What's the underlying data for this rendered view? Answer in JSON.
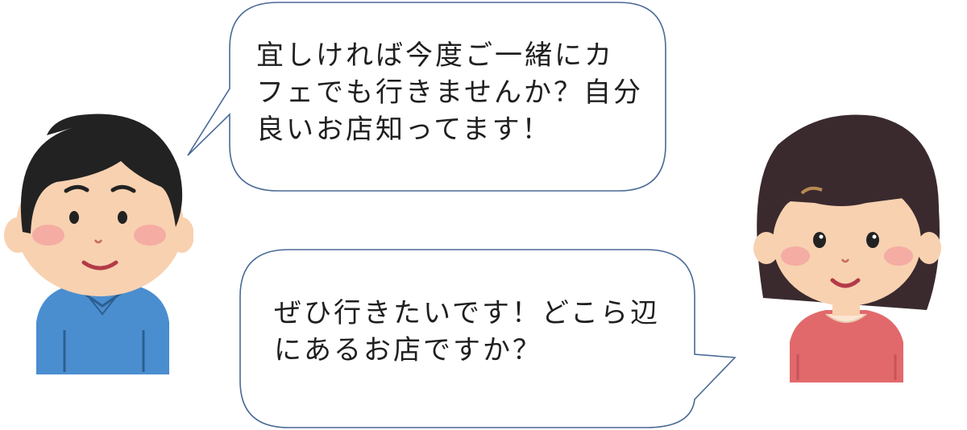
{
  "speech": {
    "man": {
      "lines": [
        "宜しければ今度ご一緒にカ",
        "フェでも行きませんか？自分",
        "良いお店知ってます！"
      ]
    },
    "woman": {
      "lines": [
        "ぜひ行きたいです！どこら辺",
        "にあるお店ですか？"
      ]
    }
  },
  "colors": {
    "bubble_outline": "#4a6a96",
    "man_shirt": "#4a8ed0",
    "woman_shirt": "#e2696b",
    "hair": "#222222",
    "skin": "#f8d1b0",
    "cheek": "#f3a2a0"
  },
  "icons": {
    "man": "man-illustration",
    "woman": "woman-illustration"
  }
}
